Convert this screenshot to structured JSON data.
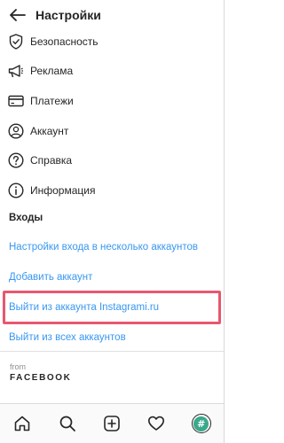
{
  "header": {
    "title": "Настройки",
    "back_icon": "arrow-left-icon"
  },
  "menu": [
    {
      "label": "Безопасность",
      "icon": "shield-check-icon"
    },
    {
      "label": "Реклама",
      "icon": "megaphone-icon"
    },
    {
      "label": "Платежи",
      "icon": "credit-card-icon"
    },
    {
      "label": "Аккаунт",
      "icon": "user-circle-icon"
    },
    {
      "label": "Справка",
      "icon": "help-circle-icon"
    },
    {
      "label": "Информация",
      "icon": "info-circle-icon"
    }
  ],
  "logins": {
    "heading": "Входы",
    "multi_account": "Настройки входа в несколько аккаунтов",
    "add_account": "Добавить аккаунт",
    "logout_account": "Выйти из аккаунта Instagrami.ru",
    "logout_all": "Выйти из всех аккаунтов"
  },
  "footer": {
    "from": "from",
    "brand": "FACEBOOK"
  },
  "tabbar": {
    "tabs": [
      "home-icon",
      "search-icon",
      "new-post-icon",
      "heart-icon",
      "profile-avatar"
    ],
    "avatar_glyph": "#"
  },
  "colors": {
    "link": "#3897f0",
    "highlight": "#e8576e",
    "text": "#262626"
  }
}
